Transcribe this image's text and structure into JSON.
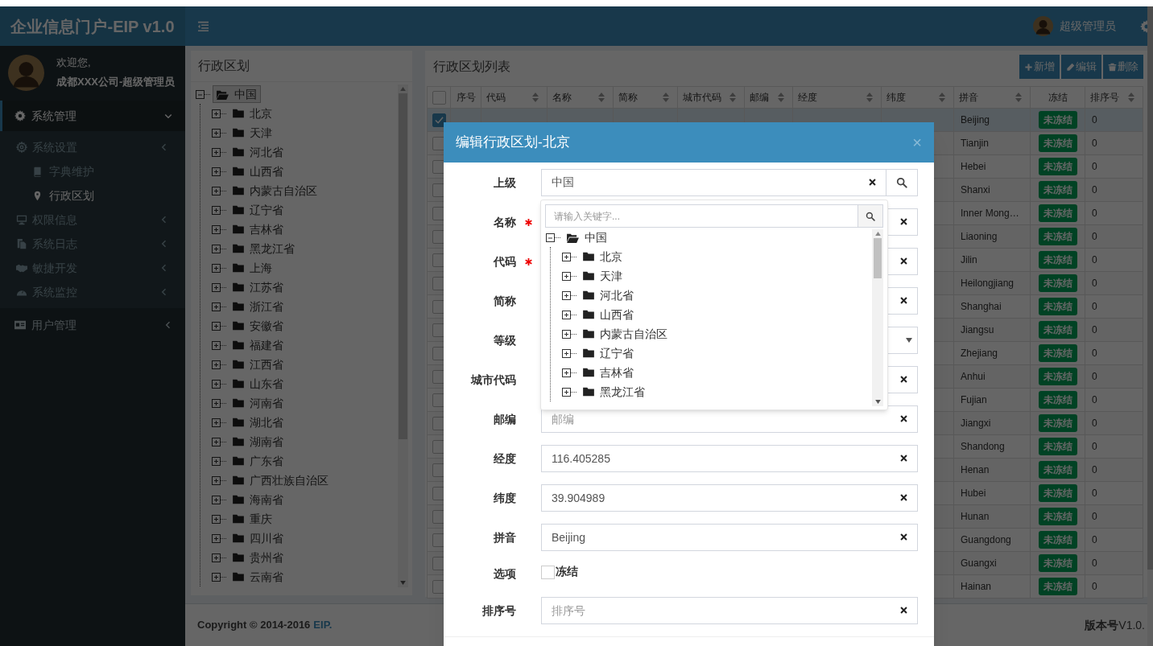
{
  "header": {
    "logo": "企业信息门户-EIP v1.0",
    "user_name": "超级管理员"
  },
  "sidebar": {
    "welcome": "欢迎您,",
    "user": "成都XXX公司-超级管理员",
    "menu": [
      {
        "label": "系统管理",
        "selected": true,
        "expanded": true,
        "children": [
          {
            "label": "系统设置",
            "selected": false,
            "children": [
              {
                "label": "字典维护",
                "selected": false
              },
              {
                "label": "行政区划",
                "selected": true
              }
            ]
          },
          {
            "label": "权限信息",
            "selected": false
          },
          {
            "label": "系统日志",
            "selected": false
          },
          {
            "label": "敏捷开发",
            "selected": false
          },
          {
            "label": "系统监控",
            "selected": false
          }
        ]
      },
      {
        "label": "用户管理",
        "selected": false,
        "expanded": false
      }
    ]
  },
  "region_panel": {
    "title": "行政区划",
    "tree": [
      {
        "label": "中国",
        "expanded": true,
        "selected": true,
        "children": [
          {
            "label": "北京",
            "expanded": false,
            "selected": false
          },
          {
            "label": "天津",
            "expanded": false,
            "selected": false
          },
          {
            "label": "河北省",
            "expanded": false,
            "selected": false
          },
          {
            "label": "山西省",
            "expanded": false,
            "selected": false
          },
          {
            "label": "内蒙古自治区",
            "expanded": false,
            "selected": false
          },
          {
            "label": "辽宁省",
            "expanded": false,
            "selected": false
          },
          {
            "label": "吉林省",
            "expanded": false,
            "selected": false
          },
          {
            "label": "黑龙江省",
            "expanded": false,
            "selected": false
          },
          {
            "label": "上海",
            "expanded": false,
            "selected": false
          },
          {
            "label": "江苏省",
            "expanded": false,
            "selected": false
          },
          {
            "label": "浙江省",
            "expanded": false,
            "selected": false
          },
          {
            "label": "安徽省",
            "expanded": false,
            "selected": false
          },
          {
            "label": "福建省",
            "expanded": false,
            "selected": false
          },
          {
            "label": "江西省",
            "expanded": false,
            "selected": false
          },
          {
            "label": "山东省",
            "expanded": false,
            "selected": false
          },
          {
            "label": "河南省",
            "expanded": false,
            "selected": false
          },
          {
            "label": "湖北省",
            "expanded": false,
            "selected": false
          },
          {
            "label": "湖南省",
            "expanded": false,
            "selected": false
          },
          {
            "label": "广东省",
            "expanded": false,
            "selected": false
          },
          {
            "label": "广西壮族自治区",
            "expanded": false,
            "selected": false
          },
          {
            "label": "海南省",
            "expanded": false,
            "selected": false
          },
          {
            "label": "重庆",
            "expanded": false,
            "selected": false
          },
          {
            "label": "四川省",
            "expanded": false,
            "selected": false
          },
          {
            "label": "贵州省",
            "expanded": false,
            "selected": false
          },
          {
            "label": "云南省",
            "expanded": false,
            "selected": false
          }
        ]
      }
    ]
  },
  "table": {
    "title": "行政区划列表",
    "buttons": [
      {
        "label": "新增"
      },
      {
        "label": "编辑"
      },
      {
        "label": "删除"
      }
    ],
    "all_checked": false,
    "columns": [
      {
        "label": "序号",
        "sortable": false
      },
      {
        "label": "代码",
        "sortable": true
      },
      {
        "label": "名称",
        "sortable": true
      },
      {
        "label": "简称",
        "sortable": true
      },
      {
        "label": "城市代码",
        "sortable": true
      },
      {
        "label": "邮编",
        "sortable": true
      },
      {
        "label": "经度",
        "sortable": true
      },
      {
        "label": "纬度",
        "sortable": true
      },
      {
        "label": "拼音",
        "sortable": true
      },
      {
        "label": "冻结",
        "sortable": false
      },
      {
        "label": "排序号",
        "sortable": true
      }
    ],
    "rows": [
      {
        "selected": true,
        "pinyin": "Beijing",
        "status": "未冻结",
        "sort": "0"
      },
      {
        "selected": false,
        "pinyin": "Tianjin",
        "status": "未冻结",
        "sort": "0"
      },
      {
        "selected": false,
        "pinyin": "Hebei",
        "status": "未冻结",
        "sort": "0"
      },
      {
        "selected": false,
        "pinyin": "Shanxi",
        "status": "未冻结",
        "sort": "0"
      },
      {
        "selected": false,
        "pinyin": "Inner Mong…",
        "status": "未冻结",
        "sort": "0"
      },
      {
        "selected": false,
        "pinyin": "Liaoning",
        "status": "未冻结",
        "sort": "0"
      },
      {
        "selected": false,
        "pinyin": "Jilin",
        "status": "未冻结",
        "sort": "0"
      },
      {
        "selected": false,
        "pinyin": "Heilongjiang",
        "status": "未冻结",
        "sort": "0"
      },
      {
        "selected": false,
        "pinyin": "Shanghai",
        "status": "未冻结",
        "sort": "0"
      },
      {
        "selected": false,
        "pinyin": "Jiangsu",
        "status": "未冻结",
        "sort": "0"
      },
      {
        "selected": false,
        "pinyin": "Zhejiang",
        "status": "未冻结",
        "sort": "0"
      },
      {
        "selected": false,
        "pinyin": "Anhui",
        "status": "未冻结",
        "sort": "0"
      },
      {
        "selected": false,
        "pinyin": "Fujian",
        "status": "未冻结",
        "sort": "0"
      },
      {
        "selected": false,
        "pinyin": "Jiangxi",
        "status": "未冻结",
        "sort": "0"
      },
      {
        "selected": false,
        "pinyin": "Shandong",
        "status": "未冻结",
        "sort": "0"
      },
      {
        "selected": false,
        "pinyin": "Henan",
        "status": "未冻结",
        "sort": "0"
      },
      {
        "selected": false,
        "pinyin": "Hubei",
        "status": "未冻结",
        "sort": "0"
      },
      {
        "selected": false,
        "pinyin": "Hunan",
        "status": "未冻结",
        "sort": "0"
      },
      {
        "selected": false,
        "pinyin": "Guangdong",
        "status": "未冻结",
        "sort": "0"
      },
      {
        "selected": false,
        "pinyin": "Guangxi",
        "status": "未冻结",
        "sort": "0"
      },
      {
        "selected": false,
        "pinyin": "Hainan",
        "status": "未冻结",
        "sort": "0"
      }
    ]
  },
  "footer": {
    "copyright": "Copyright © 2014-2016",
    "link": "EIP.",
    "version": "**版本号**V1.0."
  },
  "modal": {
    "title": "编辑行政区划-北京",
    "close": "×",
    "fields": [
      {
        "label": "上级",
        "kind": "lookup",
        "required": false,
        "value": "中国"
      },
      {
        "label": "名称",
        "kind": "text",
        "required": true
      },
      {
        "label": "代码",
        "kind": "text",
        "required": true
      },
      {
        "label": "简称",
        "kind": "text",
        "required": false
      },
      {
        "label": "等级",
        "kind": "select",
        "required": false
      },
      {
        "label": "城市代码",
        "kind": "text",
        "required": false
      },
      {
        "label": "邮编",
        "kind": "text",
        "required": false,
        "placeholder": "邮编"
      },
      {
        "label": "经度",
        "kind": "text",
        "required": false,
        "value": "116.405285"
      },
      {
        "label": "纬度",
        "kind": "text",
        "required": false,
        "value": "39.904989"
      },
      {
        "label": "拼音",
        "kind": "text",
        "required": false,
        "value": "Beijing"
      },
      {
        "label": "选项",
        "kind": "checkbox",
        "required": false,
        "option": "冻结",
        "checked": false
      },
      {
        "label": "排序号",
        "kind": "text",
        "required": false,
        "placeholder": "排序号"
      }
    ],
    "dropdown": {
      "placeholder": "请输入关键字...",
      "tree": [
        {
          "label": "中国",
          "expanded": true,
          "children": [
            {
              "label": "北京",
              "expanded": false
            },
            {
              "label": "天津",
              "expanded": false
            },
            {
              "label": "河北省",
              "expanded": false
            },
            {
              "label": "山西省",
              "expanded": false
            },
            {
              "label": "内蒙古自治区",
              "expanded": false
            },
            {
              "label": "辽宁省",
              "expanded": false
            },
            {
              "label": "吉林省",
              "expanded": false
            },
            {
              "label": "黑龙江省",
              "expanded": false
            }
          ]
        }
      ]
    }
  }
}
